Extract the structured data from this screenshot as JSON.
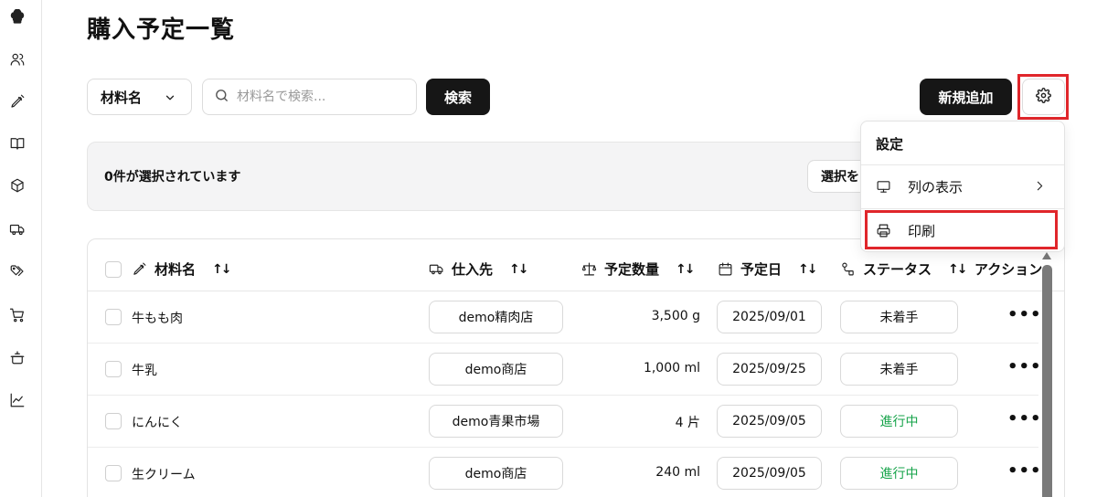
{
  "page": {
    "title": "購入予定一覧"
  },
  "sidebar": {
    "items": [
      {
        "icon": "chef-hat-icon"
      },
      {
        "icon": "users-icon"
      },
      {
        "icon": "pen-icon"
      },
      {
        "icon": "book-icon"
      },
      {
        "icon": "box-icon"
      },
      {
        "icon": "truck-icon"
      },
      {
        "icon": "tags-icon"
      },
      {
        "icon": "cart-icon"
      },
      {
        "icon": "pot-icon"
      },
      {
        "icon": "chart-icon"
      }
    ]
  },
  "toolbar": {
    "filter_field": "材料名",
    "search_placeholder": "材料名で検索...",
    "search_label": "検索",
    "add_label": "新規追加"
  },
  "selection": {
    "count_text": "0件が選択されています",
    "action_label": "選択を"
  },
  "table": {
    "columns": [
      {
        "label": "材料名",
        "icon": "pen-icon",
        "sort": "↑↓"
      },
      {
        "label": "仕入先",
        "icon": "truck-icon",
        "sort": "↑↓"
      },
      {
        "label": "予定数量",
        "icon": "scale-icon",
        "sort": "↑↓"
      },
      {
        "label": "予定日",
        "icon": "calendar-icon",
        "sort": "↑↓"
      },
      {
        "label": "ステータス",
        "icon": "status-icon",
        "sort": "↑↓"
      },
      {
        "label": "アクション"
      }
    ],
    "rows": [
      {
        "name": "牛もも肉",
        "supplier": "demo精肉店",
        "qty": "3,500 g",
        "date": "2025/09/01",
        "status": "未着手",
        "actions": "•••"
      },
      {
        "name": "牛乳",
        "supplier": "demo商店",
        "qty": "1,000 ml",
        "date": "2025/09/25",
        "status": "未着手",
        "actions": "•••"
      },
      {
        "name": "にんにく",
        "supplier": "demo青果市場",
        "qty": "4 片",
        "date": "2025/09/05",
        "status": "進行中",
        "actions": "•••"
      },
      {
        "name": "生クリーム",
        "supplier": "demo商店",
        "qty": "240 ml",
        "date": "2025/09/05",
        "status": "進行中",
        "actions": "•••"
      }
    ]
  },
  "menu": {
    "title": "設定",
    "items": [
      {
        "label": "列の表示",
        "icon": "monitor-icon",
        "arrow": "›"
      },
      {
        "label": "印刷",
        "icon": "printer-icon"
      }
    ]
  },
  "colors": {
    "accent_dark": "#161616",
    "status_in_progress": "#16a34a",
    "highlight_red": "#e0262b"
  }
}
